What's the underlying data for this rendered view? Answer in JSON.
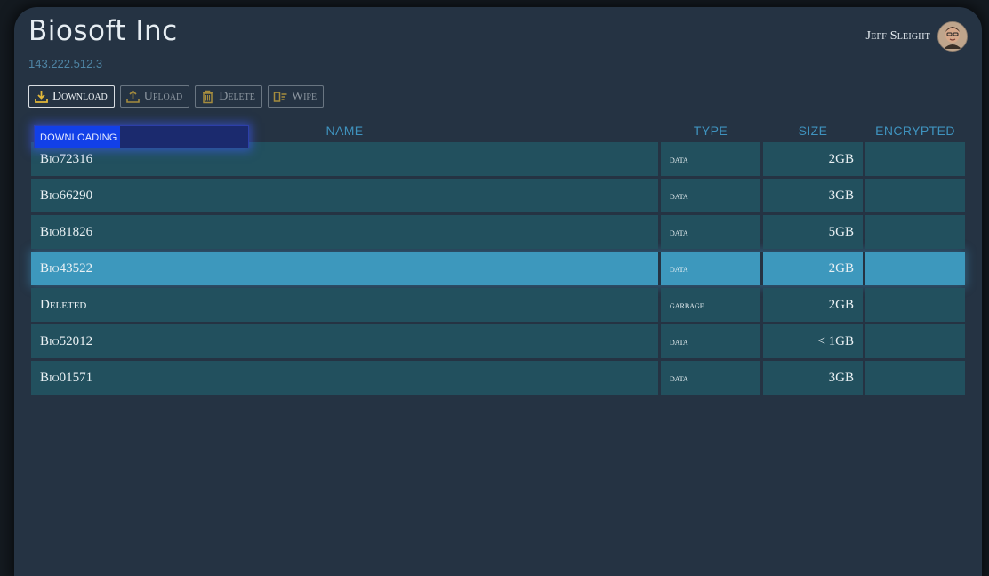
{
  "app": {
    "title": "Biosoft Inc",
    "ip": "143.222.512.3"
  },
  "user": {
    "name": "Jeff Sleight"
  },
  "toolbar": {
    "download_label": "Download",
    "upload_label": "Upload",
    "delete_label": "Delete",
    "wipe_label": "Wipe"
  },
  "columns": {
    "name": "NAME",
    "type": "TYPE",
    "size": "SIZE",
    "encrypted": "ENCRYPTED"
  },
  "progress": {
    "label": "DOWNLOADING",
    "fraction": 0.4
  },
  "files": [
    {
      "name": "Bio72316",
      "type": "data",
      "size": "2GB",
      "encrypted": ""
    },
    {
      "name": "Bio66290",
      "type": "data",
      "size": "3GB",
      "encrypted": ""
    },
    {
      "name": "Bio81826",
      "type": "data",
      "size": "5GB",
      "encrypted": ""
    },
    {
      "name": "Bio43522",
      "type": "data",
      "size": "2GB",
      "encrypted": ""
    },
    {
      "name": "Deleted",
      "type": "garbage",
      "size": "2GB",
      "encrypted": ""
    },
    {
      "name": "Bio52012",
      "type": "data",
      "size": "< 1GB",
      "encrypted": ""
    },
    {
      "name": "Bio01571",
      "type": "data",
      "size": "3GB",
      "encrypted": ""
    }
  ],
  "selected_row": 3,
  "colors": {
    "background": "#253343",
    "row": "#22505e",
    "row_selected": "#3d98bd",
    "accent": "#3f93bf",
    "icon": "#d8b43a",
    "progress_fill": "#1240e8"
  },
  "icons": {
    "download": "download-tray-icon",
    "upload": "upload-tray-icon",
    "delete": "trash-icon",
    "wipe": "wipe-icon"
  }
}
